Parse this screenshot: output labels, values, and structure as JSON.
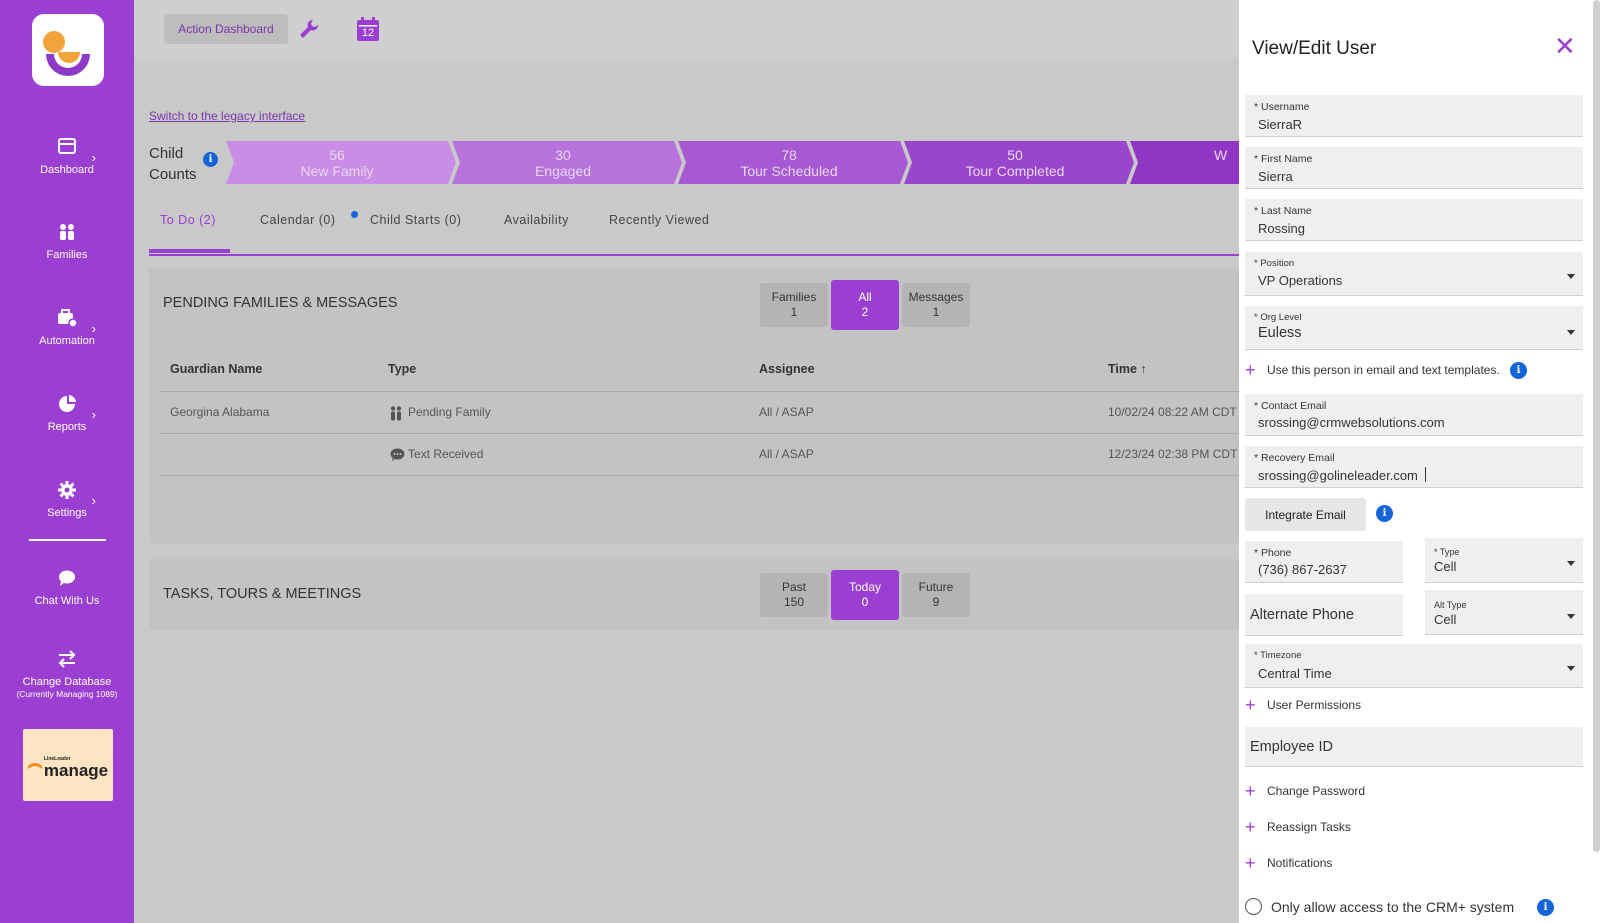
{
  "sidebar": {
    "nav": [
      {
        "label": "Dashboard",
        "icon": "dashboard-icon"
      },
      {
        "label": "Families",
        "icon": "families-icon"
      },
      {
        "label": "Automation",
        "icon": "automation-icon"
      },
      {
        "label": "Reports",
        "icon": "reports-icon"
      },
      {
        "label": "Settings",
        "icon": "gear-icon"
      },
      {
        "label": "Chat With Us",
        "icon": "chat-icon"
      },
      {
        "label": "Change Database",
        "sub": "(Currently Managing 1089)",
        "icon": "swap-icon"
      }
    ],
    "brand_small": "LineLeader",
    "brand_big": "manage",
    "colors": {
      "accent": "#9b3fd2",
      "info": "#1565d8"
    }
  },
  "topbar": {
    "action_label": "Action Dashboard",
    "calendar_day": "12"
  },
  "legacy_link": "Switch to the legacy interface",
  "child_counts": {
    "label_line1": "Child",
    "label_line2": "Counts",
    "stages": [
      {
        "count": "56",
        "name": "New Family"
      },
      {
        "count": "30",
        "name": "Engaged"
      },
      {
        "count": "78",
        "name": "Tour Scheduled"
      },
      {
        "count": "50",
        "name": "Tour Completed"
      },
      {
        "count": "",
        "name": "W"
      }
    ]
  },
  "tabs": [
    "To Do (2)",
    "Calendar (0)",
    "Child Starts (0)",
    "Availability",
    "Recently Viewed"
  ],
  "pending": {
    "title": "PENDING FAMILIES & MESSAGES",
    "filters": [
      {
        "label": "Families",
        "count": "1"
      },
      {
        "label": "All",
        "count": "2"
      },
      {
        "label": "Messages",
        "count": "1"
      }
    ],
    "columns": [
      "Guardian Name",
      "Type",
      "Assignee",
      "Time ↑"
    ],
    "rows": [
      {
        "guardian": "Georgina Alabama",
        "type": "Pending Family",
        "assignee": "All / ASAP",
        "time": "10/02/24 08:22 AM CDT"
      },
      {
        "guardian": "",
        "type": "Text Received",
        "assignee": "All / ASAP",
        "time": "12/23/24 02:38 PM CDT"
      }
    ]
  },
  "tasks": {
    "title": "TASKS, TOURS & MEETINGS",
    "filters": [
      {
        "label": "Past",
        "count": "150"
      },
      {
        "label": "Today",
        "count": "0"
      },
      {
        "label": "Future",
        "count": "9"
      }
    ]
  },
  "panel": {
    "title": "View/Edit User",
    "close": "✕",
    "username": {
      "label": "* Username",
      "value": "SierraR"
    },
    "first_name": {
      "label": "* First Name",
      "value": "Sierra"
    },
    "last_name": {
      "label": "* Last Name",
      "value": "Rossing"
    },
    "position": {
      "label": "* Position",
      "value": "VP Operations"
    },
    "org_level": {
      "label": "* Org Level",
      "value": "Euless"
    },
    "template_toggle": "Use this person in email and text templates.",
    "contact_email": {
      "label": "* Contact Email",
      "value": "srossing@crmwebsolutions.com"
    },
    "recovery_email": {
      "label": "* Recovery Email",
      "value": "srossing@golineleader.com"
    },
    "integrate_email": "Integrate Email",
    "phone": {
      "label": "* Phone",
      "value": "(736) 867-2637"
    },
    "phone_type": {
      "label": "* Type",
      "value": "Cell"
    },
    "alt_phone_placeholder": "Alternate Phone",
    "alt_type": {
      "label": "Alt Type",
      "value": "Cell"
    },
    "timezone": {
      "label": "* Timezone",
      "value": "Central Time"
    },
    "user_permissions": "User Permissions",
    "employee_id_placeholder": "Employee ID",
    "change_password": "Change Password",
    "reassign_tasks": "Reassign Tasks",
    "notifications": "Notifications",
    "crm_only": "Only allow access to the CRM+ system"
  }
}
